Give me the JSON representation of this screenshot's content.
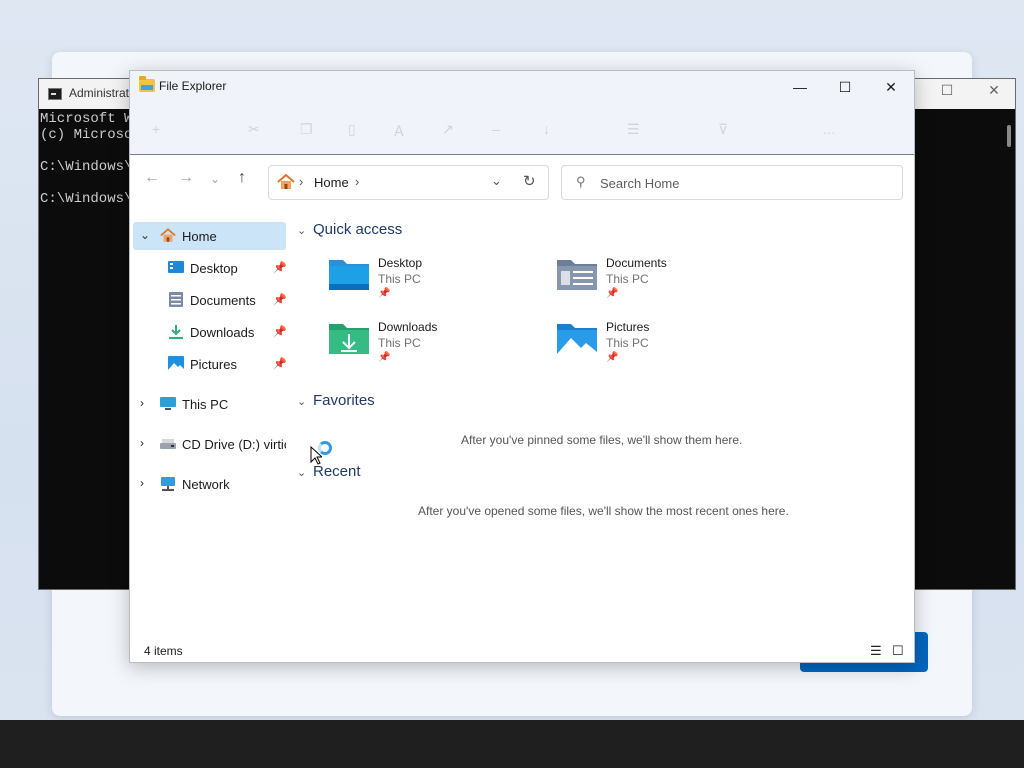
{
  "cmd": {
    "title": "Administrat",
    "lines": [
      "Microsoft Wi",
      "(c) Microso",
      "",
      "C:\\Windows\\S",
      "",
      "C:\\Windows\\S"
    ]
  },
  "explorer": {
    "title": "File Explorer",
    "window_controls": {
      "minimize": "—",
      "maximize": "☐",
      "close": "✕"
    },
    "address": {
      "crumb": "Home"
    },
    "search": {
      "placeholder": "Search Home"
    },
    "sidebar": [
      {
        "label": "Home",
        "icon": "home-icon",
        "selected": true,
        "expandable": true,
        "expanded": true
      },
      {
        "label": "Desktop",
        "icon": "desktop-icon",
        "pinned": true
      },
      {
        "label": "Documents",
        "icon": "documents-icon",
        "pinned": true
      },
      {
        "label": "Downloads",
        "icon": "downloads-icon",
        "pinned": true
      },
      {
        "label": "Pictures",
        "icon": "pictures-icon",
        "pinned": true
      },
      {
        "label": "This PC",
        "icon": "computer-icon",
        "expandable": true
      },
      {
        "label": "CD Drive (D:) virtio-w",
        "icon": "cd-drive-icon",
        "expandable": true
      },
      {
        "label": "Network",
        "icon": "network-icon",
        "expandable": true
      }
    ],
    "sections": {
      "quick_access": "Quick access",
      "favorites": "Favorites",
      "recent": "Recent"
    },
    "quick_access_items": [
      {
        "name": "Desktop",
        "location": "This PC",
        "icon": "desktop-folder-icon",
        "color": "#1e88d6"
      },
      {
        "name": "Documents",
        "location": "This PC",
        "icon": "documents-folder-icon",
        "color": "#6b7f99"
      },
      {
        "name": "Downloads",
        "location": "This PC",
        "icon": "downloads-folder-icon",
        "color": "#2fae7a"
      },
      {
        "name": "Pictures",
        "location": "This PC",
        "icon": "pictures-folder-icon",
        "color": "#1f8fe0"
      }
    ],
    "favorites_empty": "After you've pinned some files, we'll show them here.",
    "recent_empty": "After you've opened some files, we'll show the most recent ones here.",
    "status": "4 items"
  },
  "colors": {
    "selection": "#cce4f7",
    "accent": "#0067c0"
  }
}
